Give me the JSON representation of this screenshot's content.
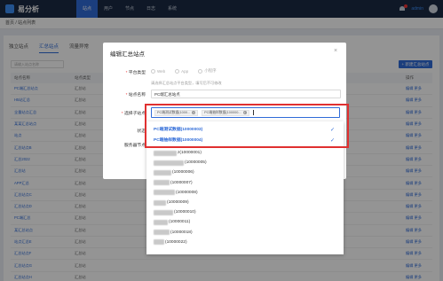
{
  "app": {
    "logo": "易分析"
  },
  "topnav": {
    "items": [
      {
        "label": "站点",
        "active": true
      },
      {
        "label": "用户",
        "active": false
      },
      {
        "label": "节点",
        "active": false
      },
      {
        "label": "日志",
        "active": false
      },
      {
        "label": "系统",
        "active": false
      }
    ],
    "username": "admin"
  },
  "breadcrumb": "首页 / 站点列表",
  "background": {
    "tabs": [
      "独立站点",
      "汇总站点",
      "流量异常"
    ],
    "search_placeholder": "请输入站点名称",
    "add_button": "+ 新建汇总站点",
    "columns": [
      "站点名称",
      "站点类型",
      "操作"
    ],
    "rows": [
      [
        "PC端汇总站点",
        "汇总站"
      ],
      [
        "H5站汇总",
        "汇总站"
      ],
      [
        "全量站点汇总",
        "汇总站"
      ],
      [
        "某某汇总站点",
        "汇总站"
      ],
      [
        "站点",
        "汇总站"
      ],
      [
        "汇总站点B",
        "汇总站"
      ],
      [
        "汇总2022",
        "汇总站"
      ],
      [
        "汇总站",
        "汇总站"
      ],
      [
        "APP汇总",
        "汇总站"
      ],
      [
        "汇总站点C",
        "汇总站"
      ],
      [
        "汇总站点D",
        "汇总站"
      ],
      [
        "PC端汇总",
        "汇总站"
      ],
      [
        "某汇总站点",
        "汇总站"
      ],
      [
        "站点汇总E",
        "汇总站"
      ],
      [
        "汇总站点F",
        "汇总站"
      ],
      [
        "汇总站点G",
        "汇总站"
      ],
      [
        "汇总站点H",
        "汇总站"
      ]
    ],
    "row_action": "编辑  更多"
  },
  "modal": {
    "title": "编辑汇总站点",
    "platform_label": "平台类型",
    "platform_options": [
      "Web",
      "App",
      "小程序"
    ],
    "platform_hint": "请选择汇总站点平台类型，填写后不可修改",
    "name_label": "站点名称",
    "name_value": "PC端汇总站点",
    "child_label": "选择子站点",
    "status_label": "状态",
    "service_label": "服务器节点",
    "chips": [
      "PC端测试数据(1000...",
      "PC端抽样数据(100000..."
    ]
  },
  "dropdown": {
    "selected": [
      {
        "label": "PC端测试数据(10000003)"
      },
      {
        "label": "PC端抽样数据(10000004)"
      }
    ],
    "others": [
      {
        "suffix": "z(10000001)"
      },
      {
        "suffix": "(10000005)"
      },
      {
        "suffix": "(10000006)"
      },
      {
        "suffix": "(10000007)"
      },
      {
        "suffix": "(10000008)"
      },
      {
        "suffix": "(10000009)"
      },
      {
        "suffix": "(10000010)"
      },
      {
        "suffix": "(10000011)"
      },
      {
        "suffix": "(10000018)"
      },
      {
        "suffix": "(10000022)"
      }
    ]
  }
}
